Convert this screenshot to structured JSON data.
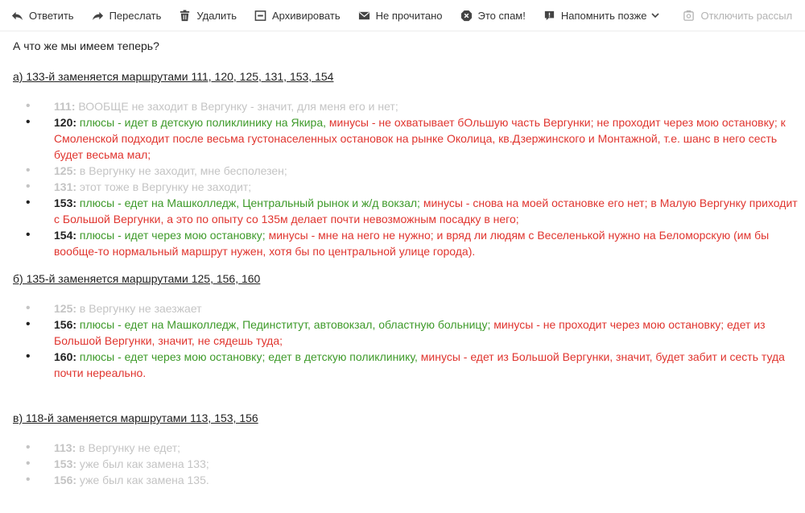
{
  "toolbar": {
    "reply": "Ответить",
    "forward": "Переслать",
    "delete": "Удалить",
    "archive": "Архивировать",
    "unread": "Не прочитано",
    "spam": "Это спам!",
    "remind": "Напомнить позже",
    "unsubscribe": "Отключить рассыл"
  },
  "message": {
    "intro": "А что же мы имеем теперь?",
    "sections": [
      {
        "heading": "а) 133-й заменяется маршрутами 111, 120, 125, 131, 153, 154",
        "items": [
          {
            "num": "111:",
            "text": "ВООБЩЕ не заходит в Вергунку - значит, для меня его и нет;"
          },
          {
            "num": "120:",
            "pros": "плюсы - идет в детскую поликлинику на Якира,",
            "cons": "минусы - не охватывает бОльшую часть Вергунки; не проходит через мою остановку; к Смоленской подходит после весьма густонаселенных остановок на рынке Околица, кв.Дзержинского и Монтажной, т.е. шанс в него сесть будет весьма мал;"
          },
          {
            "num": "125:",
            "text": "в Вергунку не заходит, мне бесполезен;"
          },
          {
            "num": "131:",
            "text": "этот тоже в Вергунку не заходит;"
          },
          {
            "num": "153:",
            "pros": "плюсы - едет на Машколледж, Центральный рынок и ж/д вокзал;",
            "cons": "минусы - снова на моей остановке его нет; в Малую Вергунку приходит с Большой Вергунки, а это по опыту со 135м делает почти невозможным посадку в него;"
          },
          {
            "num": "154:",
            "pros": "плюсы - идет через мою остановку;",
            "cons": "минусы - мне на него не нужно; и вряд ли людям с Веселенькой нужно на Беломорскую (им бы вообще-то нормальный маршрут нужен, хотя бы по центральной улице города)."
          }
        ]
      },
      {
        "heading": "б) 135-й заменяется маршрутами 125, 156, 160",
        "items": [
          {
            "num": "125:",
            "text": "в Вергунку не заезжает"
          },
          {
            "num": "156:",
            "pros": "плюсы - едет на Машколледж, Пединститут, автовокзал, областную больницу;",
            "cons": "минусы - не проходит через мою остановку; едет из Большой Вергунки, значит, не сядешь туда;"
          },
          {
            "num": "160:",
            "pros": "плюсы - едет через мою остановку; едет в детскую поликлинику,",
            "cons": "минусы - едет из Большой Вергунки, значит, будет забит и сесть туда почти нереально."
          }
        ]
      },
      {
        "heading": "в) 118-й заменяется маршрутами 113, 153, 156",
        "items": [
          {
            "num": "113:",
            "text": "в Вергунку не едет;"
          },
          {
            "num": "153:",
            "text": "уже был как замена 133;"
          },
          {
            "num": "156:",
            "text": "уже был как замена 135."
          }
        ]
      }
    ]
  },
  "colors": {
    "pros": "#3e9a2a",
    "cons": "#e0352f",
    "inactive": "#c4c4c4"
  }
}
